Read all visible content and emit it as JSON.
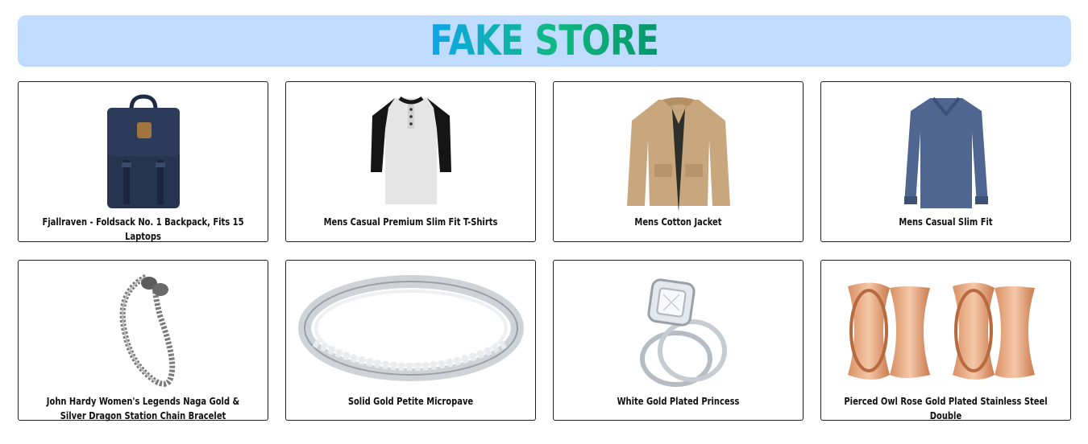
{
  "header": {
    "title": "FAKE STORE"
  },
  "products": [
    {
      "title": "Fjallraven - Foldsack No. 1 Backpack, Fits 15 Laptops",
      "icon": "backpack-icon"
    },
    {
      "title": "Mens Casual Premium Slim Fit T-Shirts",
      "icon": "tshirt-icon"
    },
    {
      "title": "Mens Cotton Jacket",
      "icon": "jacket-icon"
    },
    {
      "title": "Mens Casual Slim Fit",
      "icon": "longsleeve-icon"
    },
    {
      "title": "John Hardy Women's Legends Naga Gold & Silver Dragon Station Chain Bracelet",
      "icon": "bracelet-icon"
    },
    {
      "title": "Solid Gold Petite Micropave",
      "icon": "ring-icon"
    },
    {
      "title": "White Gold Plated Princess",
      "icon": "diamond-ring-icon"
    },
    {
      "title": "Pierced Owl Rose Gold Plated Stainless Steel Double",
      "icon": "plugs-icon"
    }
  ],
  "colors": {
    "header_bg": "#bfdbfe",
    "title_gradient_start": "#0ea5e9",
    "title_gradient_end": "#059669"
  }
}
